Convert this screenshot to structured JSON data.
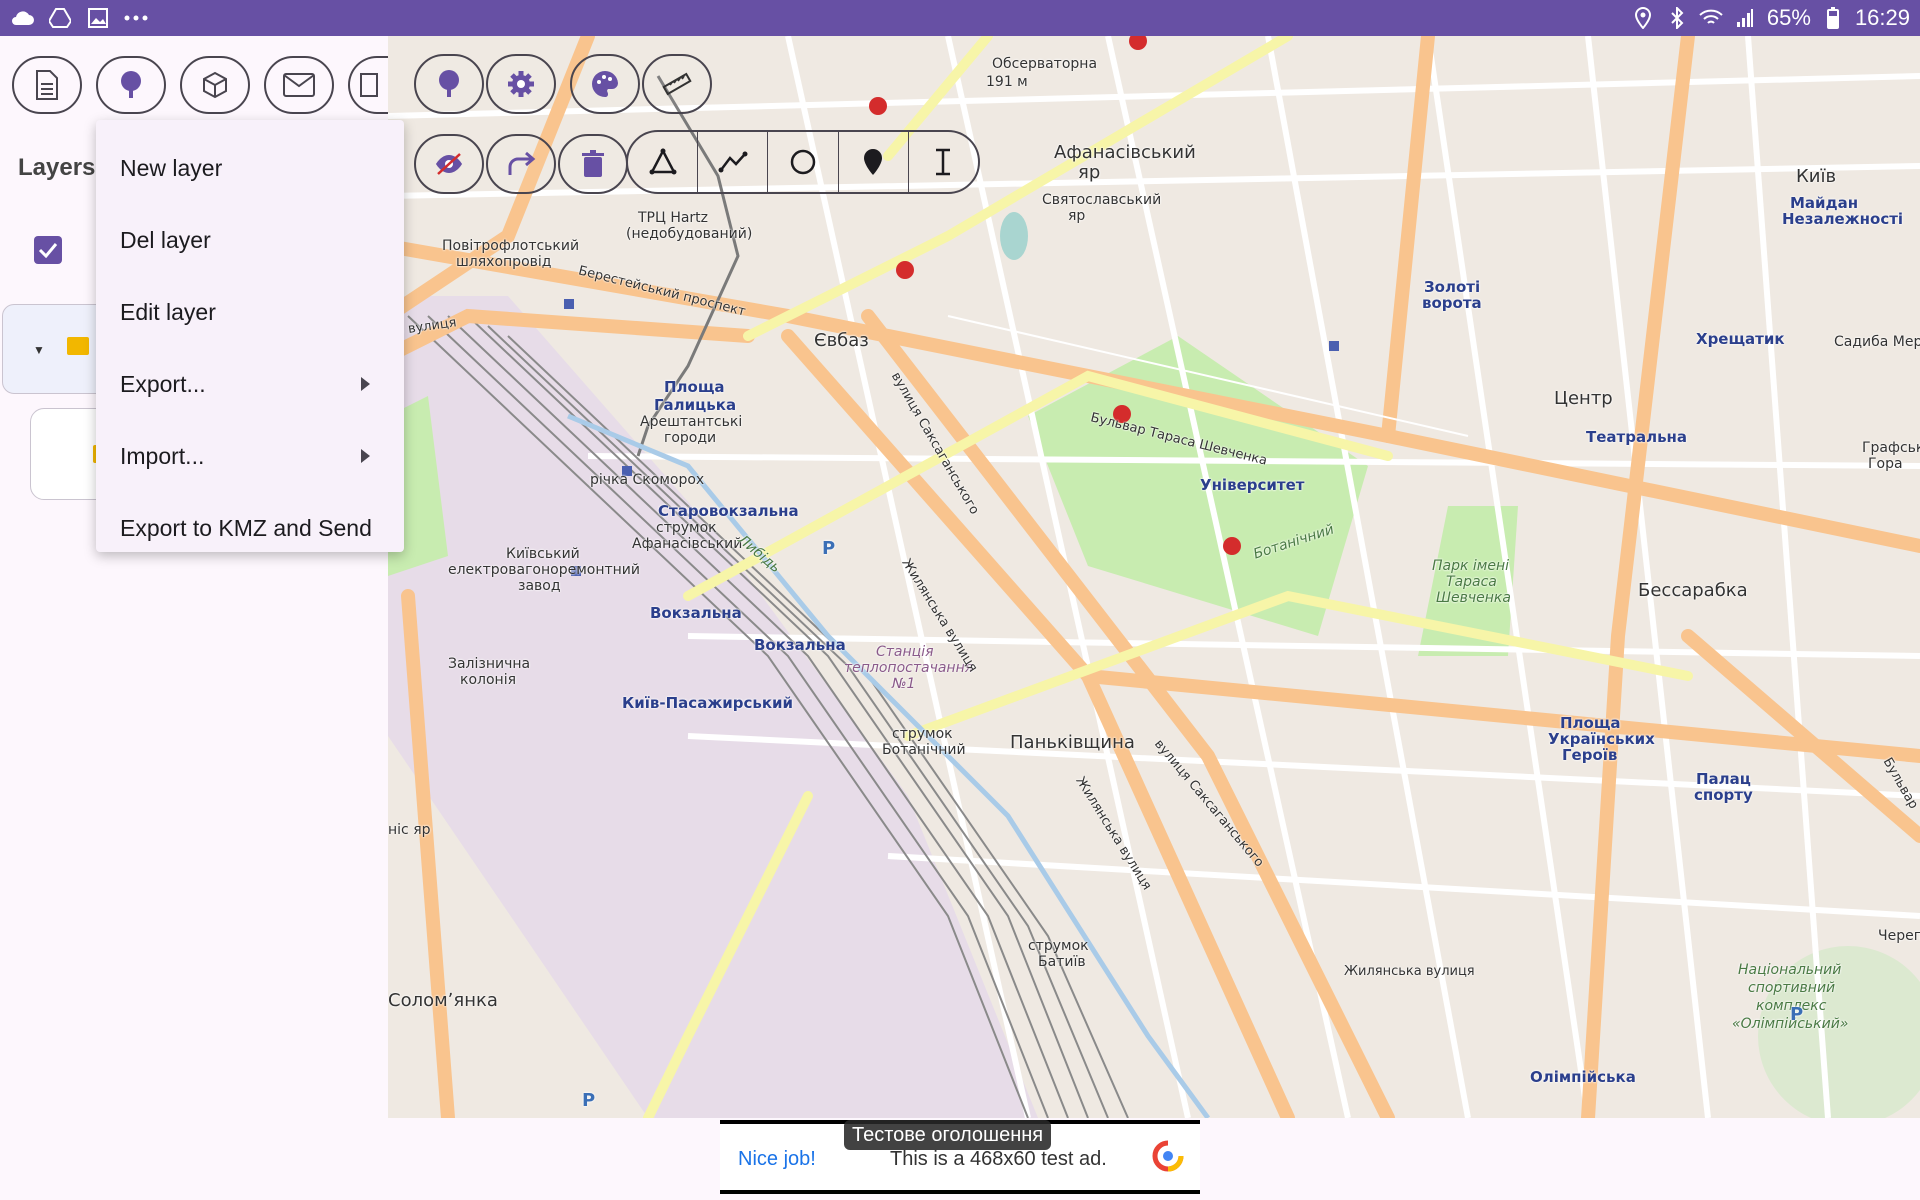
{
  "status_bar": {
    "battery": "65%",
    "time": "16:29",
    "left_icons": [
      "cloud-icon",
      "drive-icon",
      "image-icon",
      "more-dots-icon"
    ],
    "right_icons": [
      "location-icon",
      "bluetooth-icon",
      "wifi-icon",
      "signal-icon",
      "battery-icon"
    ]
  },
  "left_panel": {
    "toolbar_icons": [
      "document-icon",
      "tree-icon",
      "cube-icon",
      "mail-icon",
      "map-book-icon"
    ],
    "layers_label": "Layers:",
    "layer_checked": true
  },
  "map_toolbar": {
    "top_row": [
      "tree-icon",
      "gear-icon",
      "palette-icon",
      "ruler-icon"
    ],
    "second_row": [
      "eye-off-icon",
      "redo-icon",
      "trash-icon"
    ],
    "draw_tools": [
      "polygon-icon",
      "polyline-icon",
      "circle-icon",
      "pin-icon",
      "text-cursor-icon"
    ]
  },
  "menu": {
    "items": [
      {
        "label": "New layer",
        "submenu": false
      },
      {
        "label": "Del layer",
        "submenu": false
      },
      {
        "label": "Edit layer",
        "submenu": false
      },
      {
        "label": "Export...",
        "submenu": true
      },
      {
        "label": "Import...",
        "submenu": true
      },
      {
        "label": "Export to KMZ and Send",
        "submenu": false
      }
    ]
  },
  "map_labels": {
    "obs": "Обсерваторна",
    "obs_h": "191 м",
    "afan_yar": "Афанасівський",
    "afan_yar2": "яр",
    "svyat": "Святославський",
    "svyat2": "яр",
    "kyiv": "Київ",
    "maidan": "Майдан",
    "maidan2": "Незалежності",
    "zoloti": "Золоті",
    "zoloti2": "ворота",
    "khreshch": "Хрещатик",
    "sadyba": "Садиба Мер",
    "tsentr": "Центр",
    "teatr": "Театральна",
    "grafska": "Графська",
    "grafska2": "Гора",
    "trc": "ТРЦ Hartz",
    "trc2": "(недобудований)",
    "povitr": "Повітрофлотський",
    "povitr2": "шляхопровід",
    "berest": "Берестейський проспект",
    "evbaz": "Євбаз",
    "vul": "ка вулиця",
    "ploshcha": "Площа",
    "galytska": "Галицька",
    "aresht": "Арештантські",
    "aresht2": "городи",
    "skomor": "річка Скоморох",
    "starovok": "Старовокзальна",
    "strumok": "струмок",
    "afan2": "Афанасівський",
    "lybid": "Либідь",
    "kyivskyi": "Київський",
    "elektro": "електровагоноремонтний",
    "zavod": "завод",
    "vokzalna1": "Вокзальна",
    "vokzalna2": "Вокзальна",
    "zaliz": "Залізнична",
    "koloniya": "колонія",
    "kyiv_pas": "Київ-Пасажирський",
    "stantsiya": "Станція",
    "stantsiya2": "теплопостачання",
    "stantsiya3": "№1",
    "strumok_bot": "струмок",
    "botan": "Ботанічний",
    "pankiv": "Паньківщина",
    "univ": "Університет",
    "botan_garden": "Ботанічний",
    "park": "Парк імені",
    "park2": "Тараса",
    "park3": "Шевченка",
    "besarab": "Бессарабка",
    "ploshcha_ukr": "Площа",
    "ploshcha_ukr2": "Українських",
    "ploshcha_ukr3": "Героїв",
    "palats": "Палац",
    "palats2": "спорту",
    "shevchenka": "Бульвар Тараса Шевченка",
    "saksag": "вулиця Саксаганського",
    "zhyl": "Жилянська вулиця",
    "zhyl2": "Жилянська вулиця",
    "zhyl3": "Жилянська вулиця",
    "saksag2": "вулиця Саксаганського",
    "strumok_bat": "струмок",
    "batyi": "Батиїв",
    "natsional": "Національний",
    "natsional2": "спортивний",
    "natsional3": "комплекс",
    "natsional4": "«Олімпійський»",
    "olimp": "Олімпійська",
    "solom": "Соломʼянка",
    "chereп": "Черепа",
    "bulv": "Бульвар",
    "nis_yar": "ніс яр",
    "parking": "P"
  },
  "ad": {
    "badge": "Тестове оголошення",
    "nice": "Nice job!",
    "text": "This is a 468x60 test ad."
  },
  "colors": {
    "status_bar": "#6750a4",
    "accent": "#6750a4",
    "menu_bg": "#f8f1fa",
    "map_bg": "#f2efe9"
  }
}
